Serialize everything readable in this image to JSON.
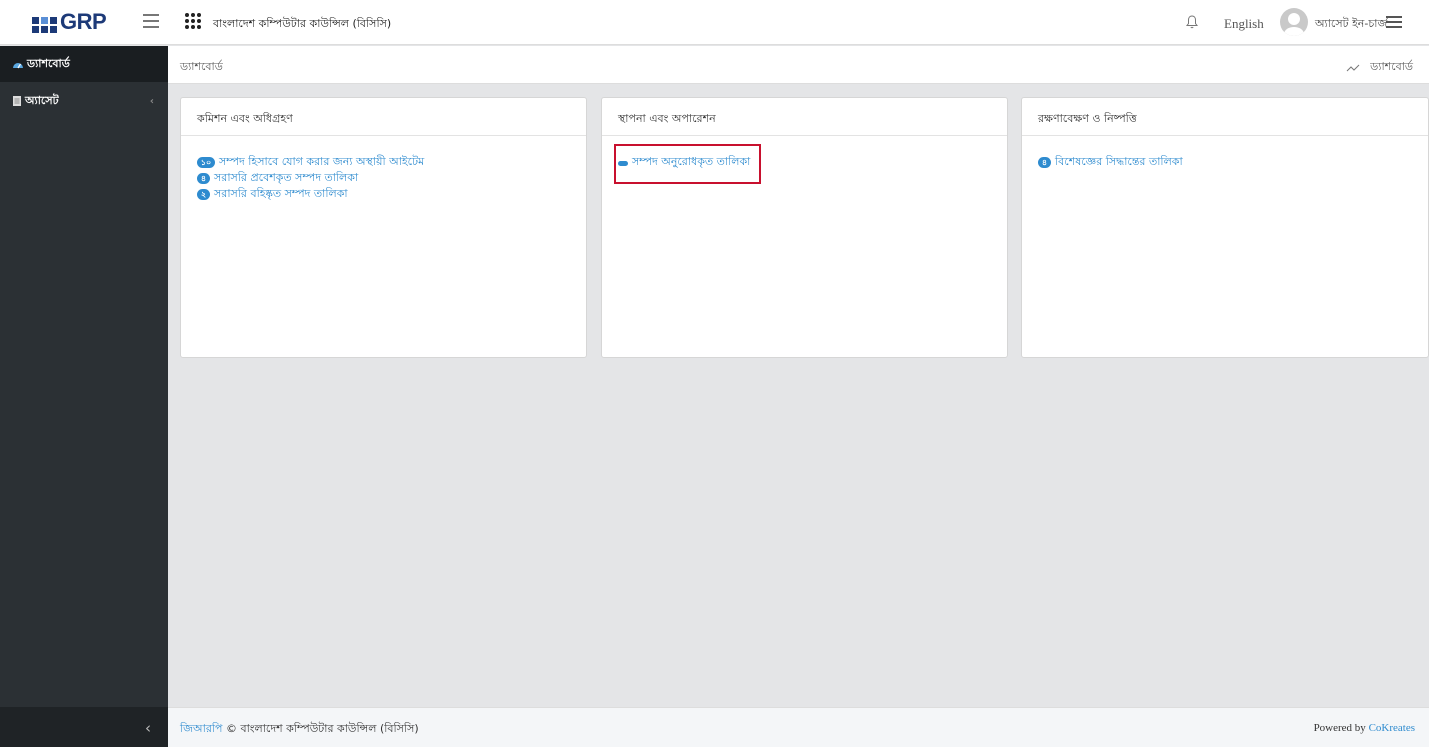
{
  "header": {
    "logo_text": "GRP",
    "org_title": "বাংলাদেশ কম্পিউটার কাউন্সিল (বিসিসি)",
    "language_label": "English",
    "user_name": "অ্যাসেট ইন-চার্জ"
  },
  "sidebar": {
    "items": [
      {
        "label": "ড্যাশবোর্ড",
        "icon": "dashboard-icon"
      },
      {
        "label": "অ্যাসেট",
        "icon": "document-icon"
      }
    ],
    "chevron": "‹",
    "collapse": "‹"
  },
  "breadcrumb": {
    "left": "ড্যাশবোর্ড",
    "right": "ড্যাশবোর্ড"
  },
  "cards": [
    {
      "title": "কমিশন এবং অধিগ্রহণ",
      "links": [
        {
          "badge": "১০",
          "label": "সম্পদ হিসাবে যোগ করার জন্য অস্থায়ী আইটেম"
        },
        {
          "badge": "৪",
          "label": "সরাসরি প্রবেশকৃত সম্পদ তালিকা"
        },
        {
          "badge": "২",
          "label": "সরাসরি বহিষ্কৃত সম্পদ তালিকা"
        }
      ]
    },
    {
      "title": "স্থাপনা এবং অপারেশন",
      "links": [
        {
          "badge": "",
          "label": "সম্পদ অনুরোধকৃত তালিকা"
        }
      ]
    },
    {
      "title": "রক্ষণাবেক্ষণ ও নিষ্পত্তি",
      "links": [
        {
          "badge": "৪",
          "label": "বিশেষজ্ঞের সিদ্ধান্তের তালিকা"
        }
      ]
    }
  ],
  "footer": {
    "brand": "জিআরপি",
    "copyright": " © বাংলাদেশ কম্পিউটার কাউন্সিল (বিসিসি)",
    "powered_by": "Powered by ",
    "vendor": "CoKreates"
  },
  "colors": {
    "accent": "#2e8bcf",
    "sidebar": "#2b3034",
    "highlight": "#c8102e"
  }
}
